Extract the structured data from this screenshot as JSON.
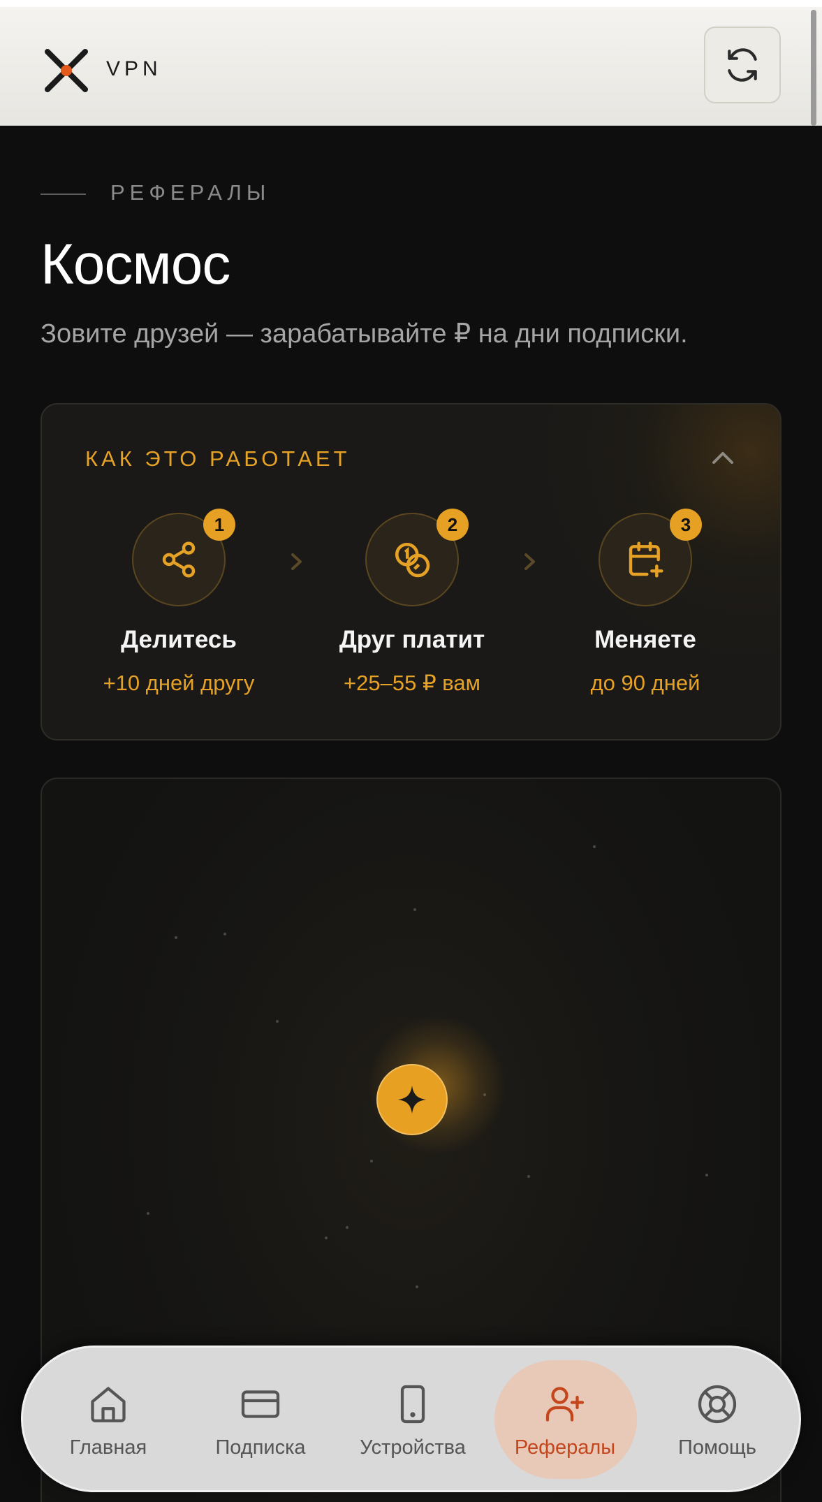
{
  "header": {
    "brand": "VPN",
    "logo_icon": "x-logo-icon",
    "refresh_icon": "refresh-icon"
  },
  "page": {
    "eyebrow": "РЕФЕРАЛЫ",
    "title": "Космос",
    "subtitle": "Зовите друзей — зарабатывайте ₽ на дни подписки."
  },
  "how_it_works": {
    "title": "КАК ЭТО РАБОТАЕТ",
    "steps": [
      {
        "badge": "1",
        "icon": "share-icon",
        "title": "Делитесь",
        "subtitle": "+10 дней другу"
      },
      {
        "badge": "2",
        "icon": "coins-icon",
        "title": "Друг платит",
        "subtitle": "+25–55 ₽ вам"
      },
      {
        "badge": "3",
        "icon": "calendar-plus-icon",
        "title": "Меняете",
        "subtitle": "до 90 дней"
      }
    ]
  },
  "space": {
    "center_icon": "sparkle-icon"
  },
  "nav": {
    "items": [
      {
        "label": "Главная",
        "icon": "home-icon"
      },
      {
        "label": "Подписка",
        "icon": "card-icon"
      },
      {
        "label": "Устройства",
        "icon": "phone-icon"
      },
      {
        "label": "Рефералы",
        "icon": "user-plus-icon",
        "active": true
      },
      {
        "label": "Помощь",
        "icon": "lifebuoy-icon"
      }
    ]
  },
  "colors": {
    "accent": "#e6a226",
    "active_nav": "#c4461c",
    "background": "#0e0e0e"
  }
}
